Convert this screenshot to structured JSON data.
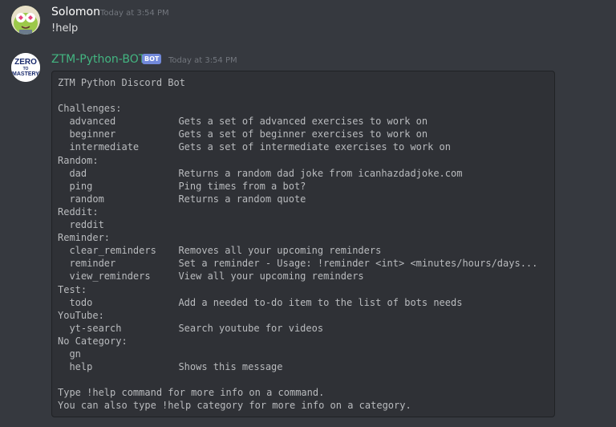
{
  "messages": [
    {
      "author": "Solomon",
      "author_color": "#ffffff",
      "timestamp": "Today at 3:54 PM",
      "text": "!help"
    },
    {
      "author": "ZTM-Python-BOT",
      "author_color": "#43b581",
      "bot_tag": "BOT",
      "timestamp": "Today at 3:54 PM",
      "avatar_text": [
        "ZERO",
        "TO",
        "MASTERY"
      ]
    }
  ],
  "help": {
    "title": "ZTM Python Discord Bot",
    "sections": [
      {
        "name": "Challenges:",
        "commands": [
          {
            "cmd": "advanced",
            "desc": "Gets a set of advanced exercises to work on"
          },
          {
            "cmd": "beginner",
            "desc": "Gets a set of beginner exercises to work on"
          },
          {
            "cmd": "intermediate",
            "desc": "Gets a set of intermediate exercises to work on"
          }
        ]
      },
      {
        "name": "Random:",
        "commands": [
          {
            "cmd": "dad",
            "desc": "Returns a random dad joke from icanhazdadjoke.com"
          },
          {
            "cmd": "ping",
            "desc": "Ping times from a bot?"
          },
          {
            "cmd": "random",
            "desc": "Returns a random quote"
          }
        ]
      },
      {
        "name": "Reddit:",
        "commands": [
          {
            "cmd": "reddit",
            "desc": ""
          }
        ]
      },
      {
        "name": "Reminder:",
        "commands": [
          {
            "cmd": "clear_reminders",
            "desc": "Removes all your upcoming reminders"
          },
          {
            "cmd": "reminder",
            "desc": "Set a reminder - Usage: !reminder <int> <minutes/hours/days..."
          },
          {
            "cmd": "view_reminders",
            "desc": "View all your upcoming reminders"
          }
        ]
      },
      {
        "name": "Test:",
        "commands": [
          {
            "cmd": "todo",
            "desc": "Add a needed to-do item to the list of bots needs"
          }
        ]
      },
      {
        "name": "YouTube:",
        "commands": [
          {
            "cmd": "yt-search",
            "desc": "Search youtube for videos"
          }
        ]
      },
      {
        "name": "No Category:",
        "commands": [
          {
            "cmd": "gn",
            "desc": ""
          },
          {
            "cmd": "help",
            "desc": "Shows this message"
          }
        ]
      }
    ],
    "footer": [
      "Type !help command for more info on a command.",
      "You can also type !help category for more info on a category."
    ]
  }
}
